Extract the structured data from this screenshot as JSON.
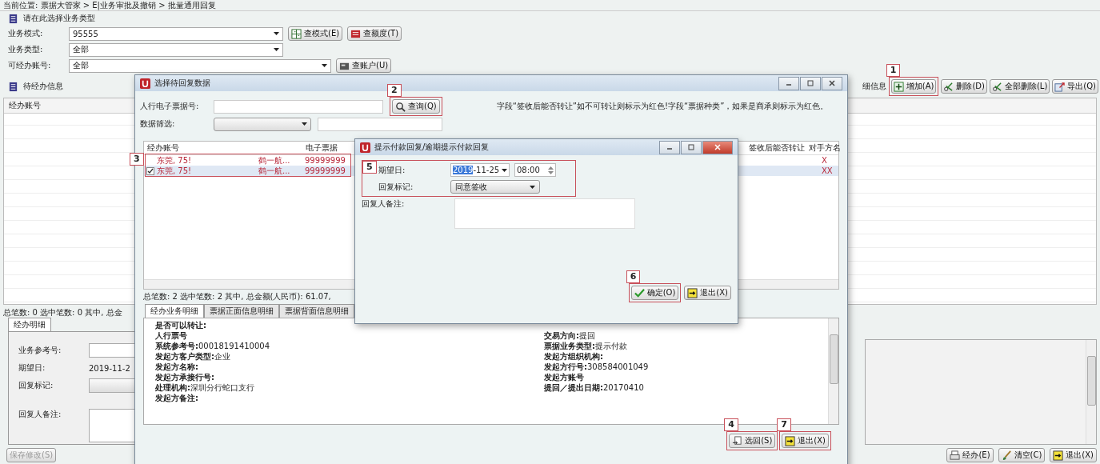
{
  "breadcrumb": "当前位置: 票据大管家 > E|业务审批及撤销 > 批量通用回复",
  "section_title": "请在此选择业务类型",
  "filters": [
    {
      "label": "业务模式:",
      "value": "95555",
      "buttons": [
        {
          "label": "查模式(E)"
        },
        {
          "label": "查额度(T)"
        }
      ]
    },
    {
      "label": "业务类型:",
      "value": "全部"
    },
    {
      "label": "可经办账号:",
      "value": "全部",
      "buttons": [
        {
          "label": "查账户(U)"
        }
      ]
    }
  ],
  "pending_title": "待经办信息",
  "detail_caption": "细信息",
  "toolbar": [
    {
      "label": "增加(A)",
      "step": "1"
    },
    {
      "label": "删除(D)"
    },
    {
      "label": "全部删除(L)"
    },
    {
      "label": "导出(Q)"
    }
  ],
  "main_table": {
    "columns": [
      "经办账号"
    ]
  },
  "summary": "总笔数: 0  选中笔数: 0  其中, 总金",
  "detail_tabs": [
    {
      "label": "经办明细",
      "selected": true
    }
  ],
  "detail_form": [
    {
      "label": "业务参考号:",
      "kind": "text"
    },
    {
      "label": "期望日:",
      "kind": "text",
      "value": "2019-11-2"
    },
    {
      "label": "回复标记:",
      "kind": "combo"
    },
    {
      "label": "回复人备注:",
      "kind": "textarea"
    }
  ],
  "save_button": {
    "label": "保存修改(S)",
    "disabled": true
  },
  "bottom_buttons": [
    {
      "label": "经办(E)"
    },
    {
      "label": "清空(C)"
    },
    {
      "label": "退出(X)"
    }
  ],
  "select_dialog": {
    "title": "选择待回复数据",
    "bill_label": "人行电子票据号:",
    "query_button": {
      "label": "查询(Q)",
      "step": "2"
    },
    "note": "字段“签收后能否转让”如不可转让则标示为红色!字段“票据种类”，如果是商承则标示为红色。",
    "filter_label": "数据筛选:",
    "columns": [
      "经办账号",
      "",
      "电子票据",
      "签收后能否转让",
      "对手方名"
    ],
    "rows_step": "3",
    "rows": [
      {
        "checked": false,
        "selected": false,
        "cells": [
          "东莞, 75!",
          "鹤一航...",
          "99999999",
          "",
          "X"
        ]
      },
      {
        "checked": true,
        "selected": true,
        "cells": [
          "东莞, 75!",
          "鹤一航...",
          "99999999",
          "",
          "XX"
        ]
      }
    ],
    "summary": "总笔数: 2  选中笔数: 2  其中, 总金额(人民币): 61.07,",
    "tabs": [
      {
        "label": "经办业务明细",
        "selected": true
      },
      {
        "label": "票据正面信息明细",
        "selected": false
      },
      {
        "label": "票据背面信息明细",
        "selected": false
      }
    ],
    "details_left": [
      {
        "label": "是否可以转让:"
      },
      {
        "label": "人行票号"
      },
      {
        "label": "系统参考号:",
        "value": "00018191410004"
      },
      {
        "label": "发起方客户类型:",
        "value": "企业"
      },
      {
        "label": "发起方名称:"
      },
      {
        "label": "发起方承接行号:"
      },
      {
        "label": "处理机构:",
        "value": "深圳分行蛇口支行"
      },
      {
        "label": "发起方备注:"
      }
    ],
    "details_right": [
      {
        "label": "交易方向:",
        "value": "提回"
      },
      {
        "label": "票据业务类型:",
        "value": "提示付款"
      },
      {
        "label": "发起方组织机构:"
      },
      {
        "label": "发起方行号:",
        "value": "308584001049"
      },
      {
        "label": "发起方账号"
      },
      {
        "label": "提回／提出日期:",
        "value": "20170410"
      }
    ],
    "buttons": [
      {
        "label": "选回(S)",
        "step": "4"
      },
      {
        "label": "退出(X)",
        "step": "7"
      }
    ]
  },
  "reply_dialog": {
    "title": "提示付款回复/逾期提示付款回复",
    "fields_step": "5",
    "date_label": "期望日:",
    "date_value": "2019-11-25",
    "time_value": "08:00",
    "reply_label": "回复标记:",
    "reply_value": "同意签收",
    "remark_label": "回复人备注:",
    "buttons": [
      {
        "label": "确定(O)",
        "step": "6"
      },
      {
        "label": "退出(X)"
      }
    ]
  }
}
